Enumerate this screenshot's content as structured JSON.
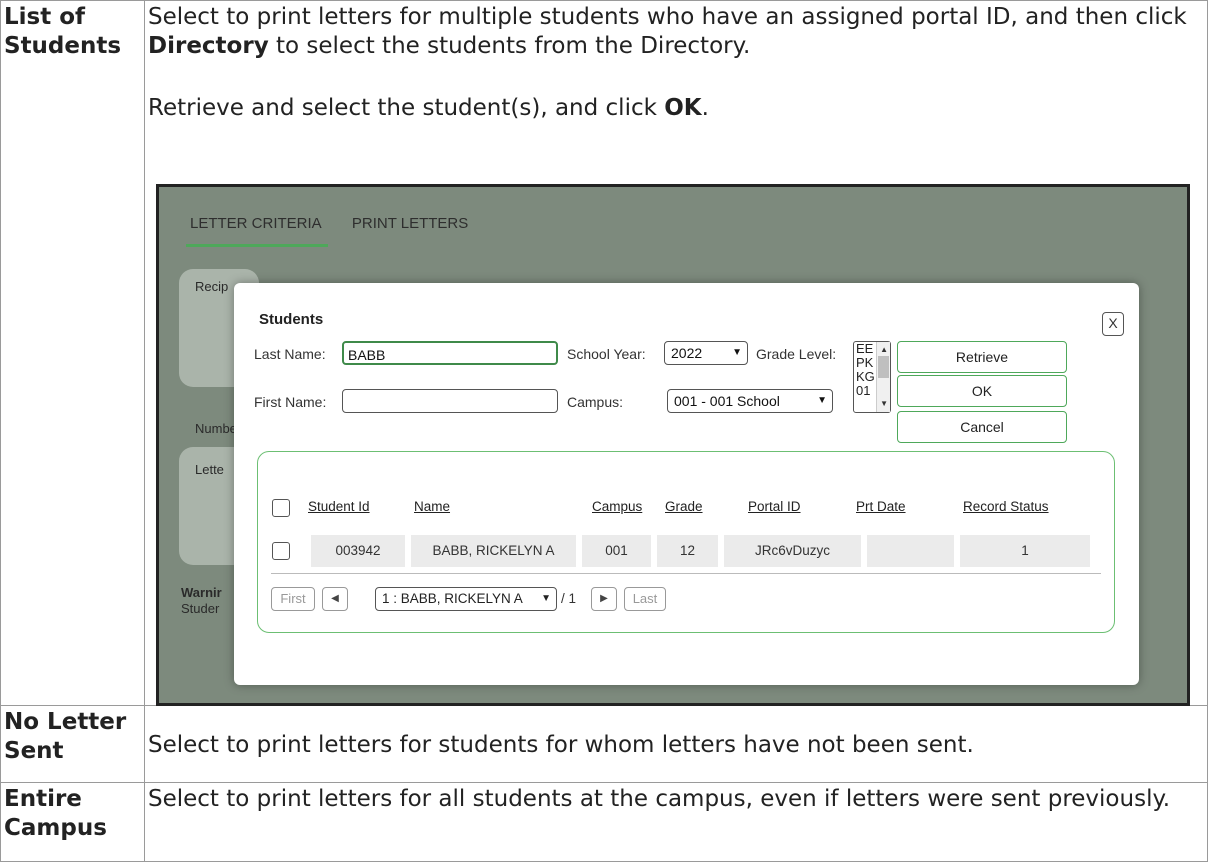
{
  "rows": [
    {
      "term": "List of Students",
      "desc_p1_pre": "Select to print letters for multiple students who have an assigned portal ID, and then click ",
      "desc_p1_bold": "Directory",
      "desc_p1_post": " to select the students from the Directory.",
      "desc_p2_pre": "Retrieve and select the student(s), and click ",
      "desc_p2_bold": "OK",
      "desc_p2_post": "."
    },
    {
      "term": "No Letter Sent",
      "desc": "Select to print letters for students for whom letters have not been sent."
    },
    {
      "term": "Entire Campus",
      "desc": "Select to print letters for all students at the campus, even if letters were sent previously."
    }
  ],
  "screenshot": {
    "tabs": [
      "LETTER CRITERIA",
      "PRINT LETTERS"
    ],
    "background_fragments": [
      "Recip",
      "Numbe",
      "Lette",
      "Warnir",
      "Studer"
    ],
    "dialog": {
      "title": "Students",
      "close_label": "X",
      "last_name_label": "Last Name:",
      "last_name_value": "BABB",
      "first_name_label": "First Name:",
      "first_name_value": "",
      "school_year_label": "School Year:",
      "school_year_value": "2022",
      "campus_label": "Campus:",
      "campus_value": "001 - 001 School",
      "grade_level_label": "Grade Level:",
      "grade_options": [
        "EE",
        "PK",
        "KG",
        "01"
      ],
      "buttons": {
        "retrieve": "Retrieve",
        "ok": "OK",
        "cancel": "Cancel"
      },
      "columns": [
        "Student Id",
        "Name",
        "Campus",
        "Grade",
        "Portal ID",
        "Prt Date",
        "Record Status"
      ],
      "rows": [
        {
          "student_id": "003942",
          "name": "BABB, RICKELYN A",
          "campus": "001",
          "grade": "12",
          "portal_id": "JRc6vDuzyc",
          "prt_date": "",
          "record_status": "1"
        }
      ],
      "pager": {
        "first": "First",
        "last": "Last",
        "selected": "1 : BABB, RICKELYN A",
        "of_text": "/ 1"
      }
    }
  }
}
